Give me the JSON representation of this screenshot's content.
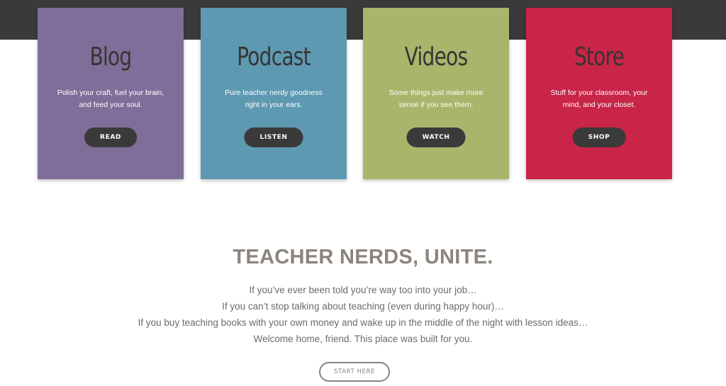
{
  "colors": {
    "top_band": "#3a3a3a",
    "blog": "#7f6e99",
    "podcast": "#5e99b2",
    "videos": "#a8b66c",
    "store": "#c82548",
    "button_dark": "#3b3a3a",
    "heading_gray": "#8a847c"
  },
  "cards": [
    {
      "title": "Blog",
      "desc_line1": "Polish your craft, fuel your brain,",
      "desc_line2": "and feed your soul.",
      "button": "READ"
    },
    {
      "title": "Podcast",
      "desc_line1": "Pure teacher nerdy goodness",
      "desc_line2": "right in your ears.",
      "button": "LISTEN"
    },
    {
      "title": "Videos",
      "desc_line1": "Some things just make more",
      "desc_line2": "sense if you see them.",
      "button": "WATCH"
    },
    {
      "title": "Store",
      "desc_line1": "Stuff for your classroom, your",
      "desc_line2": "mind, and your closet.",
      "button": "SHOP"
    }
  ],
  "unite": {
    "title": "TEACHER NERDS, UNITE.",
    "lines": [
      "If you’ve ever been told you’re way too into your job…",
      "If you can’t stop talking about teaching (even during happy hour)…",
      "If you buy teaching books with your own money and wake up in the middle of the night with lesson ideas…",
      "Welcome home, friend. This place was built for you."
    ],
    "button": "START HERE"
  }
}
